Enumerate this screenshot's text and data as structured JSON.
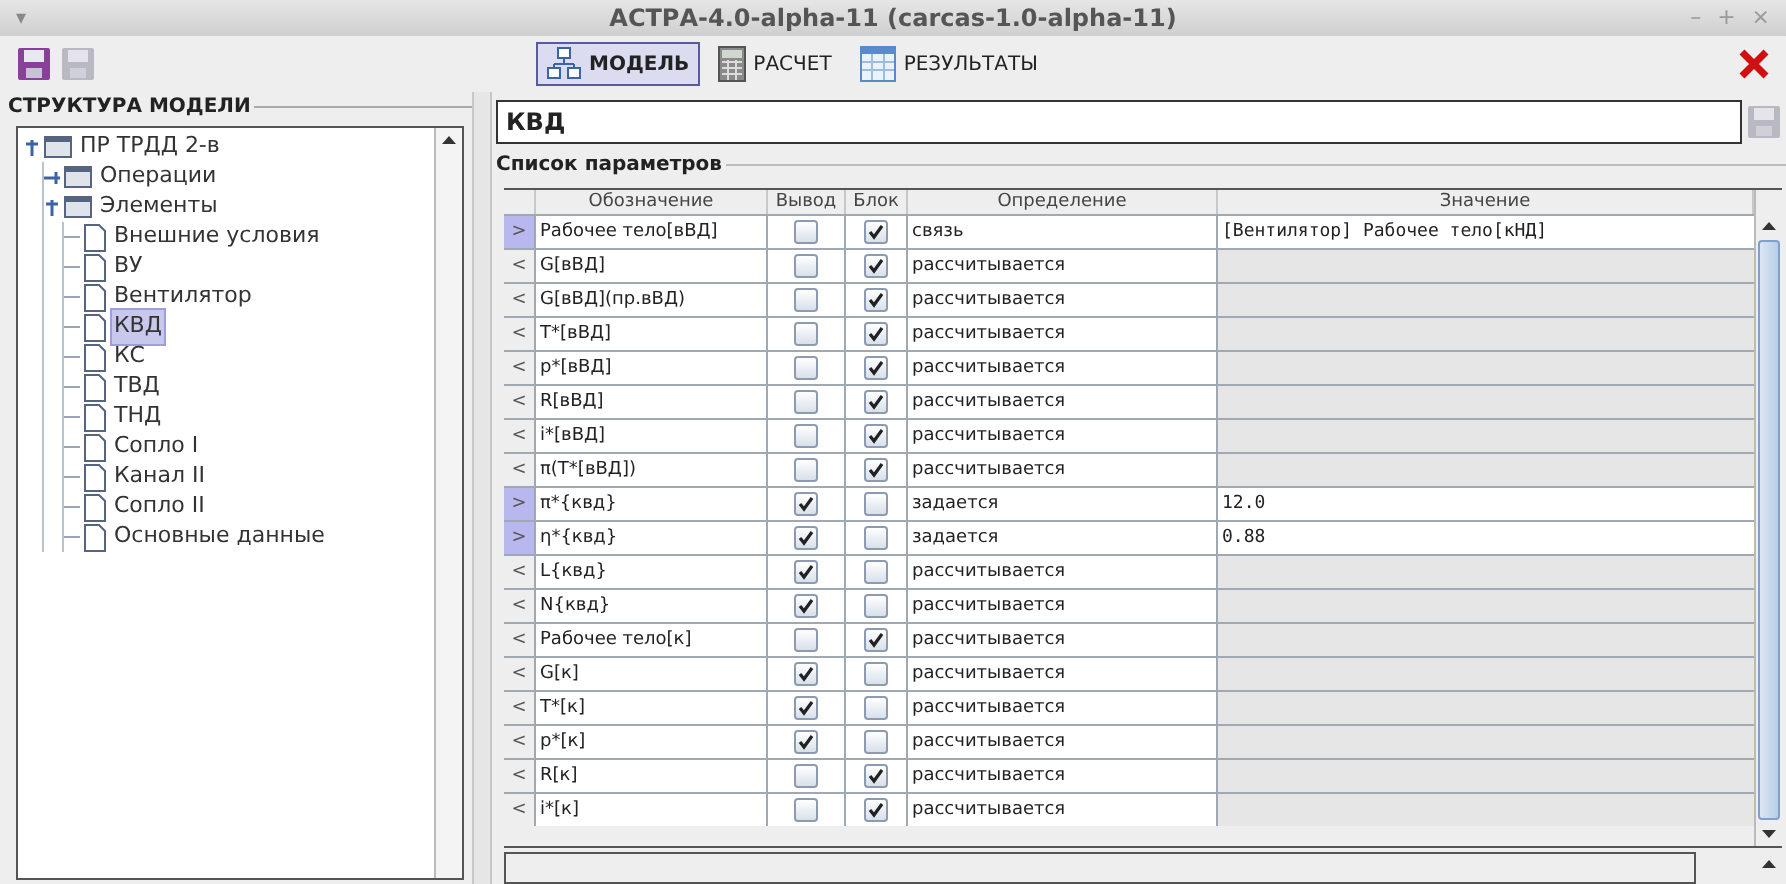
{
  "window": {
    "menu_glyph": "▾",
    "title": "АСТРА-4.0-alpha-11 (carcas-1.0-alpha-11)",
    "controls": [
      "–",
      "+",
      "×"
    ]
  },
  "toolbar": {
    "tabs": [
      {
        "label": "МОДЕЛЬ",
        "kind": "model",
        "selected": true
      },
      {
        "label": "РАСЧЕТ",
        "kind": "calc",
        "selected": false
      },
      {
        "label": "РЕЗУЛЬТАТЫ",
        "kind": "results",
        "selected": false
      }
    ]
  },
  "structure": {
    "title": "СТРУКТУРА МОДЕЛИ",
    "tree": [
      {
        "label": "ПР ТРДД 2-в",
        "kind": "folder",
        "selected": false,
        "expanded": true,
        "children": [
          {
            "label": "Операции",
            "kind": "folder",
            "selected": false,
            "expanded": false
          },
          {
            "label": "Элементы",
            "kind": "folder",
            "selected": false,
            "expanded": true,
            "children": [
              {
                "label": "Внешние условия",
                "kind": "file",
                "selected": false
              },
              {
                "label": "ВУ",
                "kind": "file",
                "selected": false
              },
              {
                "label": "Вентилятор",
                "kind": "file",
                "selected": false
              },
              {
                "label": "КВД",
                "kind": "file",
                "selected": true
              },
              {
                "label": "КС",
                "kind": "file",
                "selected": false
              },
              {
                "label": "ТВД",
                "kind": "file",
                "selected": false
              },
              {
                "label": "ТНД",
                "kind": "file",
                "selected": false
              },
              {
                "label": "Сопло I",
                "kind": "file",
                "selected": false
              },
              {
                "label": "Канал II",
                "kind": "file",
                "selected": false
              },
              {
                "label": "Сопло II",
                "kind": "file",
                "selected": false
              },
              {
                "label": "Основные данные",
                "kind": "file",
                "selected": false
              }
            ]
          }
        ]
      }
    ]
  },
  "element": {
    "name": "КВД"
  },
  "parameters": {
    "title": "Список параметров",
    "columns": [
      "Обозначение",
      "Вывод",
      "Блок",
      "Определение",
      "Значение"
    ],
    "rows": [
      {
        "marker": ">",
        "input": true,
        "name": "Рабочее тело[вВД]",
        "output": false,
        "block": true,
        "definition": "связь",
        "value": "[Вентилятор]  Рабочее  тело[кНД]"
      },
      {
        "marker": "<",
        "input": false,
        "name": "G[вВД]",
        "output": false,
        "block": true,
        "definition": "рассчитывается",
        "value": ""
      },
      {
        "marker": "<",
        "input": false,
        "name": "G[вВД](пр.вВД)",
        "output": false,
        "block": true,
        "definition": "рассчитывается",
        "value": ""
      },
      {
        "marker": "<",
        "input": false,
        "name": "T*[вВД]",
        "output": false,
        "block": true,
        "definition": "рассчитывается",
        "value": ""
      },
      {
        "marker": "<",
        "input": false,
        "name": "p*[вВД]",
        "output": false,
        "block": true,
        "definition": "рассчитывается",
        "value": ""
      },
      {
        "marker": "<",
        "input": false,
        "name": "R[вВД]",
        "output": false,
        "block": true,
        "definition": "рассчитывается",
        "value": ""
      },
      {
        "marker": "<",
        "input": false,
        "name": "i*[вВД]",
        "output": false,
        "block": true,
        "definition": "рассчитывается",
        "value": ""
      },
      {
        "marker": "<",
        "input": false,
        "name": "π(T*[вВД])",
        "output": false,
        "block": true,
        "definition": "рассчитывается",
        "value": ""
      },
      {
        "marker": ">",
        "input": true,
        "name": "π*{квд}",
        "output": true,
        "block": false,
        "definition": "задается",
        "value": "12.0"
      },
      {
        "marker": ">",
        "input": true,
        "name": "η*{квд}",
        "output": true,
        "block": false,
        "definition": "задается",
        "value": "0.88"
      },
      {
        "marker": "<",
        "input": false,
        "name": "L{квд}",
        "output": true,
        "block": false,
        "definition": "рассчитывается",
        "value": ""
      },
      {
        "marker": "<",
        "input": false,
        "name": "N{квд}",
        "output": true,
        "block": false,
        "definition": "рассчитывается",
        "value": ""
      },
      {
        "marker": "<",
        "input": false,
        "name": "Рабочее тело[к]",
        "output": false,
        "block": true,
        "definition": "рассчитывается",
        "value": ""
      },
      {
        "marker": "<",
        "input": false,
        "name": "G[к]",
        "output": true,
        "block": false,
        "definition": "рассчитывается",
        "value": ""
      },
      {
        "marker": "<",
        "input": false,
        "name": "T*[к]",
        "output": true,
        "block": false,
        "definition": "рассчитывается",
        "value": ""
      },
      {
        "marker": "<",
        "input": false,
        "name": "p*[к]",
        "output": true,
        "block": false,
        "definition": "рассчитывается",
        "value": ""
      },
      {
        "marker": "<",
        "input": false,
        "name": "R[к]",
        "output": false,
        "block": true,
        "definition": "рассчитывается",
        "value": ""
      },
      {
        "marker": "<",
        "input": false,
        "name": "i*[к]",
        "output": false,
        "block": true,
        "definition": "рассчитывается",
        "value": ""
      }
    ]
  }
}
